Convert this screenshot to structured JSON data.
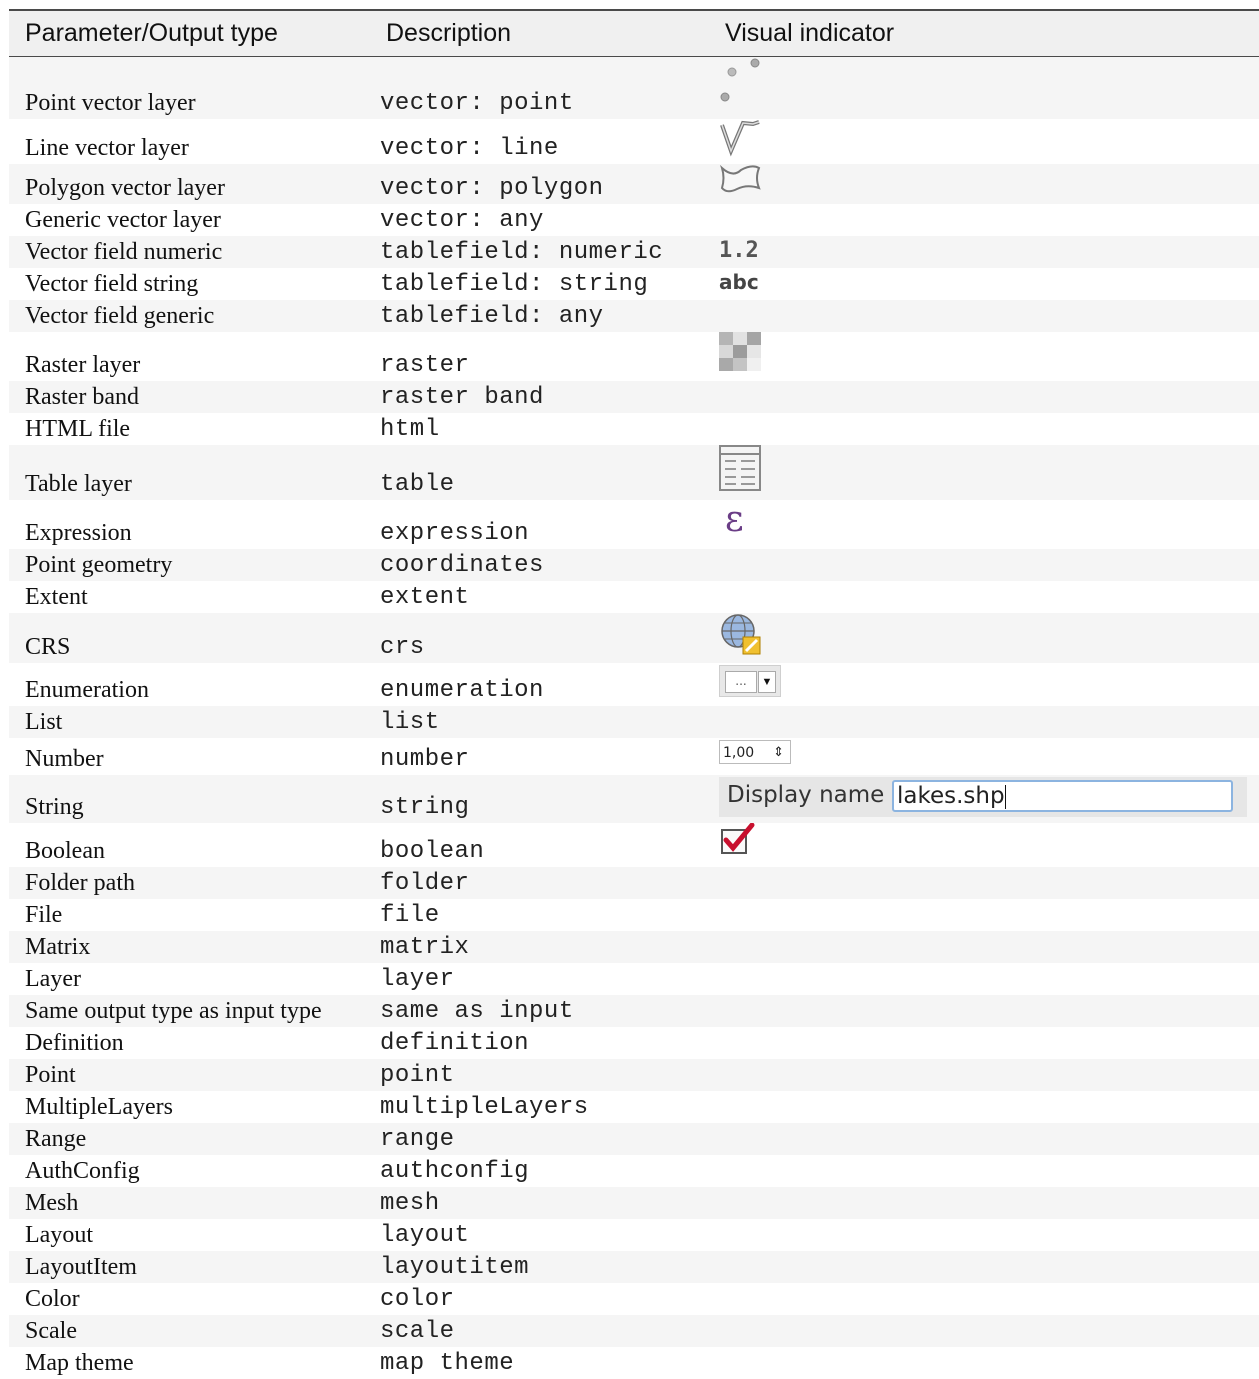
{
  "table": {
    "headers": [
      "Parameter/Output type",
      "Description",
      "Visual indicator"
    ],
    "rows": [
      {
        "name": "Point vector layer",
        "code": "vector: point",
        "icon": "point-vector-icon"
      },
      {
        "name": "Line vector layer",
        "code": "vector: line",
        "icon": "line-vector-icon"
      },
      {
        "name": "Polygon vector layer",
        "code": "vector: polygon",
        "icon": "polygon-vector-icon"
      },
      {
        "name": "Generic vector layer",
        "code": "vector: any",
        "icon": ""
      },
      {
        "name": "Vector field numeric",
        "code": "tablefield: numeric",
        "icon": "numeric-field-icon",
        "indicator_text": "1.2"
      },
      {
        "name": "Vector field string",
        "code": "tablefield: string",
        "icon": "string-field-icon",
        "indicator_text": "abc"
      },
      {
        "name": "Vector field generic",
        "code": "tablefield: any",
        "icon": ""
      },
      {
        "name": "Raster layer",
        "code": "raster",
        "icon": "raster-icon"
      },
      {
        "name": "Raster band",
        "code": "raster band",
        "icon": ""
      },
      {
        "name": "HTML file",
        "code": "html",
        "icon": ""
      },
      {
        "name": "Table layer",
        "code": "table",
        "icon": "table-icon"
      },
      {
        "name": "Expression",
        "code": "expression",
        "icon": "expression-icon",
        "indicator_text": "ε"
      },
      {
        "name": "Point geometry",
        "code": "coordinates",
        "icon": ""
      },
      {
        "name": "Extent",
        "code": "extent",
        "icon": ""
      },
      {
        "name": "CRS",
        "code": "crs",
        "icon": "crs-globe-icon"
      },
      {
        "name": "Enumeration",
        "code": "enumeration",
        "icon": "combobox-icon",
        "indicator_text": "..."
      },
      {
        "name": "List",
        "code": "list",
        "icon": ""
      },
      {
        "name": "Number",
        "code": "number",
        "icon": "spinbox-icon",
        "indicator_text": "1,00"
      },
      {
        "name": "String",
        "code": "string",
        "icon": "string-input-widget",
        "widget_label": "Display name",
        "widget_value": "lakes.shp"
      },
      {
        "name": "Boolean",
        "code": "boolean",
        "icon": "checkbox-checked-icon"
      },
      {
        "name": "Folder path",
        "code": "folder",
        "icon": ""
      },
      {
        "name": "File",
        "code": "file",
        "icon": ""
      },
      {
        "name": "Matrix",
        "code": "matrix",
        "icon": ""
      },
      {
        "name": "Layer",
        "code": "layer",
        "icon": ""
      },
      {
        "name": "Same output type as input type",
        "code": "same as input",
        "icon": ""
      },
      {
        "name": "Definition",
        "code": "definition",
        "icon": ""
      },
      {
        "name": "Point",
        "code": "point",
        "icon": ""
      },
      {
        "name": "MultipleLayers",
        "code": "multipleLayers",
        "icon": ""
      },
      {
        "name": "Range",
        "code": "range",
        "icon": ""
      },
      {
        "name": "AuthConfig",
        "code": "authconfig",
        "icon": ""
      },
      {
        "name": "Mesh",
        "code": "mesh",
        "icon": ""
      },
      {
        "name": "Layout",
        "code": "layout",
        "icon": ""
      },
      {
        "name": "LayoutItem",
        "code": "layoutitem",
        "icon": ""
      },
      {
        "name": "Color",
        "code": "color",
        "icon": ""
      },
      {
        "name": "Scale",
        "code": "scale",
        "icon": ""
      },
      {
        "name": "Map theme",
        "code": "map theme",
        "icon": ""
      }
    ]
  }
}
